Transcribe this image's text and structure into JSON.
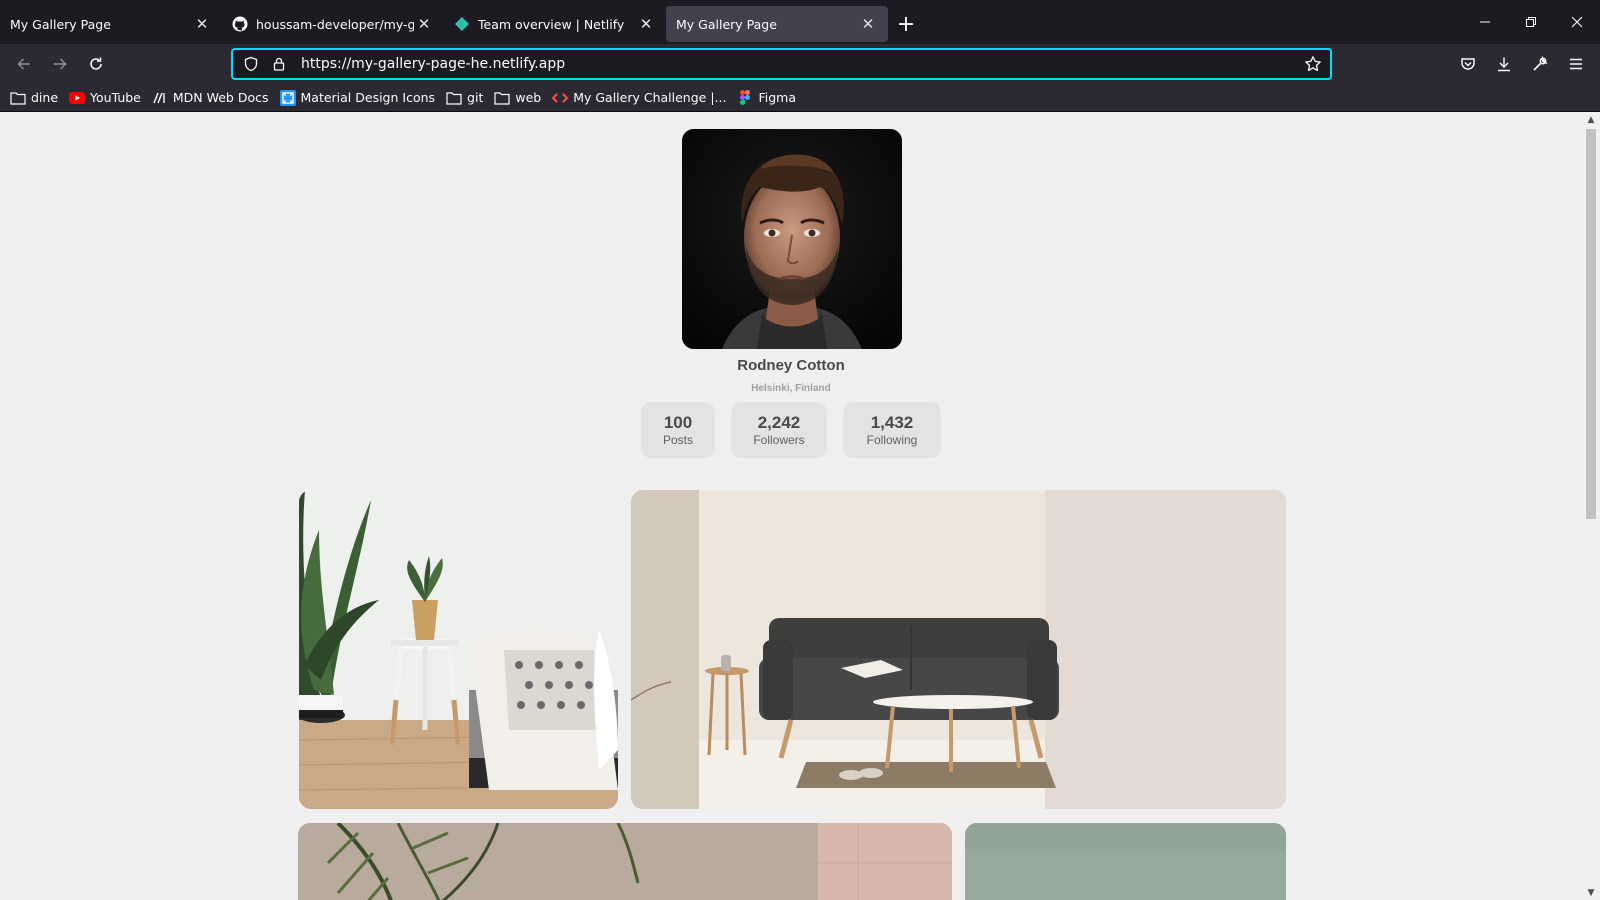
{
  "browser": {
    "tabs": [
      {
        "title": "My Gallery Page",
        "icon": "none",
        "active": false
      },
      {
        "title": "houssam-developer/my-gallery",
        "icon": "github-icon",
        "active": false
      },
      {
        "title": "Team overview | Netlify",
        "icon": "netlify-icon",
        "active": false
      },
      {
        "title": "My Gallery Page",
        "icon": "none",
        "active": true
      }
    ],
    "url": "https://my-gallery-page-he.netlify.app",
    "bookmarks": [
      {
        "label": "dine",
        "icon": "folder-icon"
      },
      {
        "label": "YouTube",
        "icon": "youtube-icon"
      },
      {
        "label": "MDN Web Docs",
        "icon": "mdn-icon"
      },
      {
        "label": "Material Design Icons",
        "icon": "mdi-icon"
      },
      {
        "label": "git",
        "icon": "folder-icon"
      },
      {
        "label": "web",
        "icon": "folder-icon"
      },
      {
        "label": "My Gallery Challenge |...",
        "icon": "devchallenges-icon"
      },
      {
        "label": "Figma",
        "icon": "figma-icon"
      }
    ],
    "colors": {
      "chrome_dark": "#1c1b22",
      "chrome": "#2b2a33",
      "url_focus": "#00ddff"
    }
  },
  "profile": {
    "name": "Rodney Cotton",
    "location": "Helsinki, Finland",
    "stats": [
      {
        "value": "100",
        "label": "Posts"
      },
      {
        "value": "2,242",
        "label": "Followers"
      },
      {
        "value": "1,432",
        "label": "Following"
      }
    ]
  },
  "gallery": {
    "photos": [
      "plant-side-table-photo",
      "dark-sofa-living-room-photo",
      "textured-wall-palm-photo",
      "sage-green-wall-photo"
    ]
  }
}
